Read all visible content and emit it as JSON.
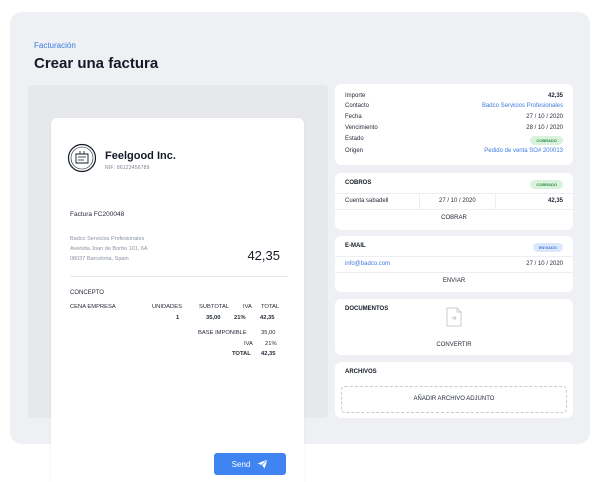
{
  "header": {
    "breadcrumb": "Facturación",
    "title": "Crear una factura"
  },
  "invoice": {
    "company_name": "Feelgood Inc.",
    "company_nif": "NIF: 86123456789",
    "invoice_number": "Factura FC200048",
    "client_lines": [
      "Badco Servicios Profesionales",
      "Avenida Joan de Borbo 101, 6A",
      "08037 Barcelona, Spain"
    ],
    "amount": "42,35",
    "concepto_heading": "CONCEPTO",
    "columns": [
      "CENA EMPRESA",
      "UNIDADES",
      "SUBTOTAL",
      "IVA",
      "TOTAL"
    ],
    "line": {
      "unidades": "1",
      "subtotal": "35,00",
      "iva": "21%",
      "total": "42,35"
    },
    "totals": [
      {
        "label": "BASE IMPONIBLE",
        "value": "35,00"
      },
      {
        "label": "IVA",
        "value": "21%"
      },
      {
        "label": "TOTAL",
        "value": "42,35"
      }
    ]
  },
  "summary": {
    "rows": [
      {
        "label": "Importe",
        "value": "42,35"
      },
      {
        "label": "Contacto",
        "value": "Badco Servicios Profesionales"
      },
      {
        "label": "Fecha",
        "value": "27 / 10 / 2020"
      },
      {
        "label": "Vencimiento",
        "value": "28 / 10 / 2020"
      },
      {
        "label": "Estado",
        "value": "COBRADO"
      },
      {
        "label": "Origen",
        "value": "Pedido de venta SO# 200013"
      }
    ]
  },
  "cobros": {
    "title": "COBROS",
    "badge": "COBRADO",
    "account": "Cuenta sabadell",
    "date": "27 / 10 / 2020",
    "amount": "42,35",
    "action": "COBRAR"
  },
  "email": {
    "title": "E-MAIL",
    "badge": "ENVIADO",
    "address": "info@badco.com",
    "date": "27 / 10 / 2020",
    "action": "ENVIAR"
  },
  "documentos": {
    "title": "DOCUMENTOS",
    "icon": "document-icon",
    "action": "CONVERTIR"
  },
  "archivos": {
    "title": "ARCHIVOS",
    "action": "AÑADIR ARCHIVO ADJUNTO"
  },
  "send": {
    "label": "Send",
    "icon": "paper-plane-icon"
  },
  "colors": {
    "accent": "#3f84f0",
    "link": "#3d7be0",
    "paid_badge": "#d9f2dc",
    "sent_badge": "#dbe8fb"
  }
}
